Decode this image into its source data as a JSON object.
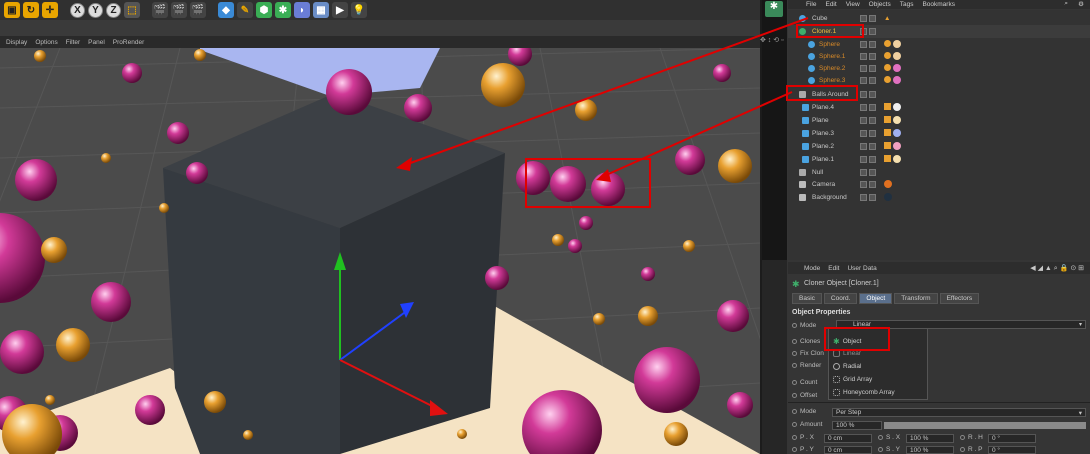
{
  "toolbar": {
    "axis_x": "X",
    "axis_y": "Y",
    "axis_z": "Z"
  },
  "viewport_menu": [
    "Display",
    "Options",
    "Filter",
    "Panel",
    "ProRender"
  ],
  "app_menu": [
    "File",
    "Edit",
    "View",
    "Objects",
    "Tags",
    "Bookmarks"
  ],
  "objects": [
    {
      "name": "Cube",
      "indent": 0,
      "icon": "cube-icon",
      "color": "#4aa3e0",
      "highlight": false
    },
    {
      "name": "Cloner.1",
      "indent": 0,
      "icon": "cloner-icon",
      "color": "#3fae6b",
      "highlight": true
    },
    {
      "name": "Sphere",
      "indent": 1,
      "icon": "sphere-icon",
      "color": "#4aa3e0",
      "highlight": false,
      "orange": true
    },
    {
      "name": "Sphere.1",
      "indent": 1,
      "icon": "sphere-icon",
      "color": "#4aa3e0",
      "highlight": false,
      "orange": true
    },
    {
      "name": "Sphere.2",
      "indent": 1,
      "icon": "sphere-icon",
      "color": "#4aa3e0",
      "highlight": false,
      "orange": true
    },
    {
      "name": "Sphere.3",
      "indent": 1,
      "icon": "sphere-icon",
      "color": "#4aa3e0",
      "highlight": false,
      "orange": true
    },
    {
      "name": "Balls Around",
      "indent": 0,
      "icon": "null-icon",
      "color": "#aaaaaa",
      "highlight": false
    },
    {
      "name": "Plane.4",
      "indent": 1,
      "icon": "plane-icon",
      "color": "#4aa3e0",
      "highlight": false
    },
    {
      "name": "Plane",
      "indent": 1,
      "icon": "plane-icon",
      "color": "#4aa3e0",
      "highlight": false
    },
    {
      "name": "Plane.3",
      "indent": 1,
      "icon": "plane-icon",
      "color": "#4aa3e0",
      "highlight": false
    },
    {
      "name": "Plane.2",
      "indent": 1,
      "icon": "plane-icon",
      "color": "#4aa3e0",
      "highlight": false
    },
    {
      "name": "Plane.1",
      "indent": 1,
      "icon": "plane-icon",
      "color": "#4aa3e0",
      "highlight": false
    },
    {
      "name": "Null",
      "indent": 0,
      "icon": "null-icon",
      "color": "#aaaaaa",
      "highlight": false
    },
    {
      "name": "Camera",
      "indent": 0,
      "icon": "camera-icon",
      "color": "#bbbbbb",
      "highlight": false
    },
    {
      "name": "Background",
      "indent": 0,
      "icon": "background-icon",
      "color": "#bbbbbb",
      "highlight": false
    }
  ],
  "attr_menu": [
    "Mode",
    "Edit",
    "User Data"
  ],
  "attr_title": "Cloner Object [Cloner.1]",
  "tabs": [
    {
      "label": "Basic",
      "active": false
    },
    {
      "label": "Coord.",
      "active": false
    },
    {
      "label": "Object",
      "active": true
    },
    {
      "label": "Transform",
      "active": false
    },
    {
      "label": "Effectors",
      "active": false
    }
  ],
  "object_properties": "Object Properties",
  "props": {
    "mode_label": "Mode",
    "mode_value": "Linear",
    "clones_label": "Clones",
    "fixclone_label": "Fix Clon",
    "render_label": "Render",
    "count_label": "Count",
    "offset_label": "Offset",
    "mode2_label": "Mode",
    "mode2_value": "Per Step",
    "amount_label": "Amount",
    "amount_value": "100 %",
    "px_label": "P . X",
    "px_value": "0 cm",
    "sx_label": "S . X",
    "sx_value": "100 %",
    "rh_label": "R . H",
    "rh_value": "0 °",
    "py_label": "P . Y",
    "py_value": "0 cm",
    "sy_label": "S . Y",
    "sy_value": "100 %",
    "rp_label": "R . P",
    "rp_value": "0 °"
  },
  "dropdown": [
    "Object",
    "Linear",
    "Radial",
    "Grid Array",
    "Honeycomb Array"
  ],
  "colors": {
    "accent_red": "#e00000",
    "magenta_ball": "#c2187a",
    "orange_ball": "#e8a030"
  }
}
